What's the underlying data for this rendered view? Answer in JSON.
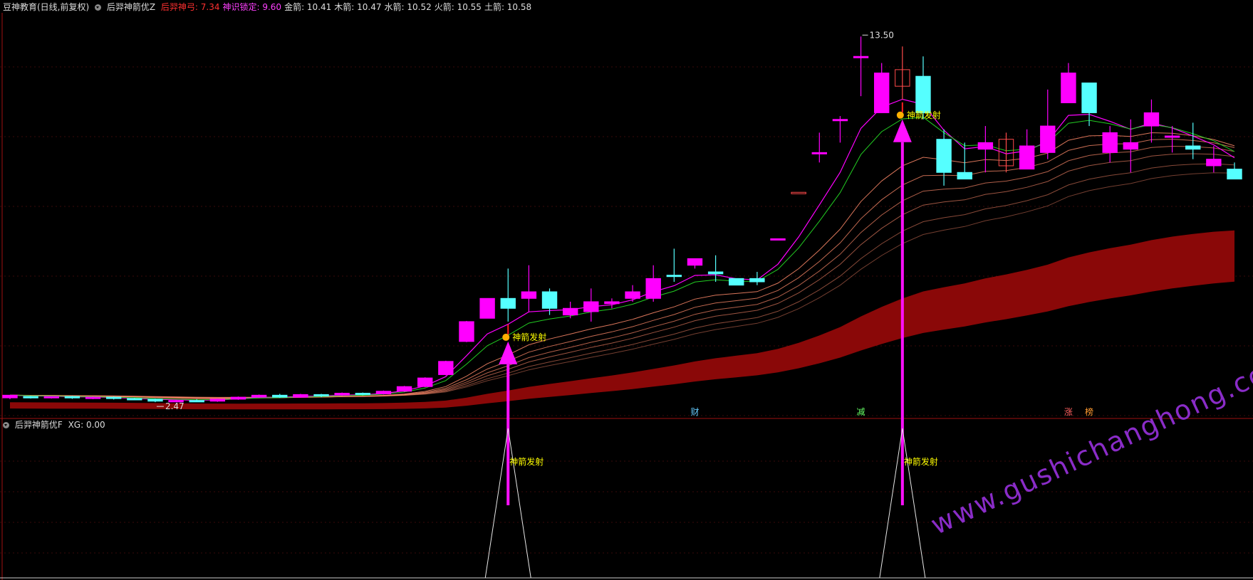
{
  "header": {
    "stock_name": "豆神教育(日线,前复权)",
    "indicator_name": "后羿神箭优Z",
    "items": [
      {
        "label": "后羿神弓: 7.34",
        "color": "#ff3030"
      },
      {
        "label": "神识锁定: 9.60",
        "color": "#ff40ff"
      },
      {
        "label": "金箭: 10.41",
        "color": "#dddddd"
      },
      {
        "label": "木箭: 10.47",
        "color": "#dddddd"
      },
      {
        "label": "水箭: 10.52",
        "color": "#dddddd"
      },
      {
        "label": "火箭: 10.55",
        "color": "#dddddd"
      },
      {
        "label": "土箭: 10.58",
        "color": "#dddddd"
      }
    ]
  },
  "sub_header": {
    "indicator_name": "后羿神箭优F",
    "value": "XG: 0.00"
  },
  "annotations": {
    "high_label": "13.50",
    "low_label": "2.47",
    "signal_label": "神箭发射",
    "markers": [
      {
        "text": "财",
        "color": "#66ccff"
      },
      {
        "text": "减",
        "color": "#66ff66"
      },
      {
        "text": "涨",
        "color": "#ff6060"
      },
      {
        "text": "榜",
        "color": "#ff9a30"
      }
    ]
  },
  "watermark": "www.gushichanghong.com",
  "colors": {
    "up": "#ff00ff",
    "down": "#55ffff",
    "hollow_up": "#ff4a4a",
    "band": "#8a0808",
    "signal_line": "#ff00ff",
    "green_line": "#22cc22",
    "fan": "#ff8a6a",
    "arrow": "#ff10ff"
  },
  "chart_data": {
    "type": "candlestick",
    "y_range": [
      2.0,
      14.0
    ],
    "candles": [
      [
        2.6,
        2.68,
        2.56,
        2.64
      ],
      [
        2.64,
        2.62,
        2.58,
        2.66
      ],
      [
        2.62,
        2.64,
        2.58,
        2.6
      ],
      [
        2.64,
        2.6,
        2.57,
        2.66
      ],
      [
        2.6,
        2.62,
        2.56,
        2.64
      ],
      [
        2.62,
        2.58,
        2.55,
        2.64
      ],
      [
        2.58,
        2.56,
        2.54,
        2.6
      ],
      [
        2.56,
        2.5,
        2.47,
        2.58
      ],
      [
        2.5,
        2.52,
        2.48,
        2.54
      ],
      [
        2.52,
        2.5,
        2.48,
        2.56
      ],
      [
        2.5,
        2.56,
        2.48,
        2.58
      ],
      [
        2.56,
        2.62,
        2.54,
        2.64
      ],
      [
        2.62,
        2.68,
        2.6,
        2.7
      ],
      [
        2.68,
        2.62,
        2.6,
        2.72
      ],
      [
        2.62,
        2.7,
        2.6,
        2.72
      ],
      [
        2.7,
        2.66,
        2.62,
        2.72
      ],
      [
        2.68,
        2.74,
        2.66,
        2.76
      ],
      [
        2.74,
        2.7,
        2.68,
        2.76
      ],
      [
        2.72,
        2.8,
        2.7,
        2.82
      ],
      [
        2.8,
        2.94,
        2.78,
        2.96
      ],
      [
        2.94,
        3.2,
        2.92,
        3.22
      ],
      [
        3.3,
        3.7,
        3.28,
        3.72
      ],
      [
        4.3,
        4.9,
        4.28,
        4.92
      ],
      [
        5.0,
        5.6,
        5.0,
        5.6
      ],
      [
        5.6,
        5.3,
        4.9,
        6.5
      ],
      [
        5.6,
        5.8,
        5.2,
        6.6
      ],
      [
        5.8,
        5.3,
        5.1,
        5.9
      ],
      [
        5.1,
        5.3,
        5.0,
        5.5
      ],
      [
        5.2,
        5.5,
        4.9,
        5.9
      ],
      [
        5.44,
        5.5,
        5.3,
        5.6
      ],
      [
        5.6,
        5.8,
        5.5,
        6.0
      ],
      [
        5.6,
        6.2,
        5.5,
        6.6
      ],
      [
        6.3,
        6.28,
        6.1,
        7.1
      ],
      [
        6.6,
        6.8,
        6.5,
        6.8
      ],
      [
        6.4,
        6.34,
        6.1,
        6.9
      ],
      [
        6.2,
        6.0,
        6.0,
        6.2
      ],
      [
        6.2,
        6.1,
        6.0,
        6.4
      ],
      [
        7.4,
        7.4,
        7.4,
        7.4
      ],
      [
        8.8,
        8.8,
        8.8,
        8.8
      ],
      [
        10.0,
        10.0,
        9.7,
        10.6
      ],
      [
        11.0,
        11.0,
        10.3,
        11.1
      ],
      [
        12.9,
        12.9,
        11.7,
        13.5
      ],
      [
        11.2,
        12.4,
        11.5,
        12.7
      ],
      [
        12.5,
        12.0,
        11.6,
        13.2
      ],
      [
        12.3,
        11.2,
        11.0,
        12.9
      ],
      [
        10.4,
        9.4,
        9.0,
        10.7
      ],
      [
        9.4,
        9.2,
        9.4,
        10.3
      ],
      [
        10.1,
        10.3,
        9.4,
        10.8
      ],
      [
        10.4,
        9.6,
        9.4,
        10.6
      ],
      [
        9.5,
        10.2,
        9.5,
        10.7
      ],
      [
        10.0,
        10.8,
        9.8,
        11.9
      ],
      [
        11.5,
        12.4,
        11.6,
        12.7
      ],
      [
        12.1,
        11.2,
        10.8,
        12.1
      ],
      [
        10.0,
        10.6,
        9.7,
        10.8
      ],
      [
        10.1,
        10.3,
        9.4,
        11.0
      ],
      [
        10.8,
        11.2,
        10.3,
        11.6
      ],
      [
        10.5,
        10.5,
        10.0,
        10.8
      ],
      [
        10.2,
        10.1,
        9.8,
        10.9
      ],
      [
        9.6,
        9.8,
        9.4,
        10.2
      ],
      [
        9.5,
        9.2,
        9.2,
        9.7
      ]
    ],
    "signals": [
      24,
      43
    ],
    "signal_series": {
      "name": "XG",
      "values": [
        0,
        0,
        0,
        0,
        0,
        0,
        0,
        0,
        0,
        0,
        0,
        0,
        0,
        0,
        0,
        0,
        0,
        0,
        0,
        0,
        0,
        0,
        0,
        0,
        1,
        0,
        0,
        0,
        0,
        0,
        0,
        0,
        0,
        0,
        0,
        0,
        0,
        0,
        0,
        0,
        0,
        0,
        0,
        1,
        0,
        0,
        0,
        0,
        0,
        0,
        0,
        0,
        0,
        0,
        0,
        0,
        0,
        0,
        0,
        0
      ]
    }
  }
}
